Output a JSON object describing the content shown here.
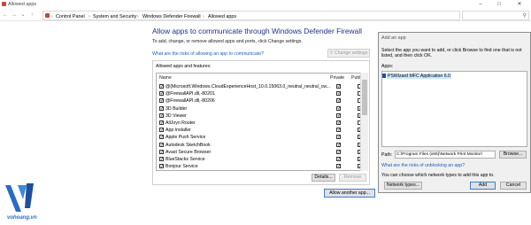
{
  "window": {
    "title": "Allowed apps"
  },
  "address": {
    "crumbs": [
      "Control Panel",
      "System and Security",
      "Windows Defender Firewall",
      "Allowed apps"
    ]
  },
  "main": {
    "heading": "Allow apps to communicate through Windows Defender Firewall",
    "subtext": "To add, change, or remove allowed apps and ports, click Change settings.",
    "risk_link": "What are the risks of allowing an app to communicate?",
    "change_settings_label": "Change settings",
    "group_label": "Allowed apps and features:",
    "columns": {
      "name": "Name",
      "private": "Private",
      "public": "Public"
    },
    "apps": [
      {
        "name": "@{Microsoft.Windows.CloudExperienceHost_10.0.15063.0_neutral_neutral_cw...",
        "checked": true,
        "private": true,
        "public": false
      },
      {
        "name": "@FirewallAPI.dll,-80201",
        "checked": true,
        "private": true,
        "public": false
      },
      {
        "name": "@FirewallAPI.dll,-80206",
        "checked": true,
        "private": true,
        "public": false
      },
      {
        "name": "3D Builder",
        "checked": true,
        "private": true,
        "public": true
      },
      {
        "name": "3D Viewer",
        "checked": true,
        "private": true,
        "public": true
      },
      {
        "name": "AllJoyn Router",
        "checked": true,
        "private": true,
        "public": false
      },
      {
        "name": "App Installer",
        "checked": true,
        "private": true,
        "public": true
      },
      {
        "name": "Apple Push Service",
        "checked": true,
        "private": true,
        "public": true
      },
      {
        "name": "Autodesk SketchBook",
        "checked": true,
        "private": true,
        "public": true
      },
      {
        "name": "Avast Secure Browser",
        "checked": true,
        "private": true,
        "public": true
      },
      {
        "name": "BlueStacks Service",
        "checked": true,
        "private": true,
        "public": true
      },
      {
        "name": "Bonjour Service",
        "checked": true,
        "private": true,
        "public": true
      }
    ],
    "details_label": "Details...",
    "remove_label": "Remove",
    "allow_another_label": "Allow another app..."
  },
  "dialog": {
    "title": "Add an app",
    "description": "Select the app you want to add, or click Browse to find one that is not listed, and then click OK.",
    "apps_label": "Apps:",
    "selected_app": "PSWizard MFC Application 6.0",
    "path_label": "Path:",
    "path_value": "C:\\Program Files (x86)\\Network Print Monitor\\",
    "browse_label": "Browse...",
    "unblock_link": "What are the risks of unblocking an app?",
    "network_text": "You can choose which network types to add this app to.",
    "network_types_label": "Network types...",
    "add_label": "Add",
    "cancel_label": "Cancel"
  },
  "watermark": {
    "text": "vohoang.vn"
  }
}
